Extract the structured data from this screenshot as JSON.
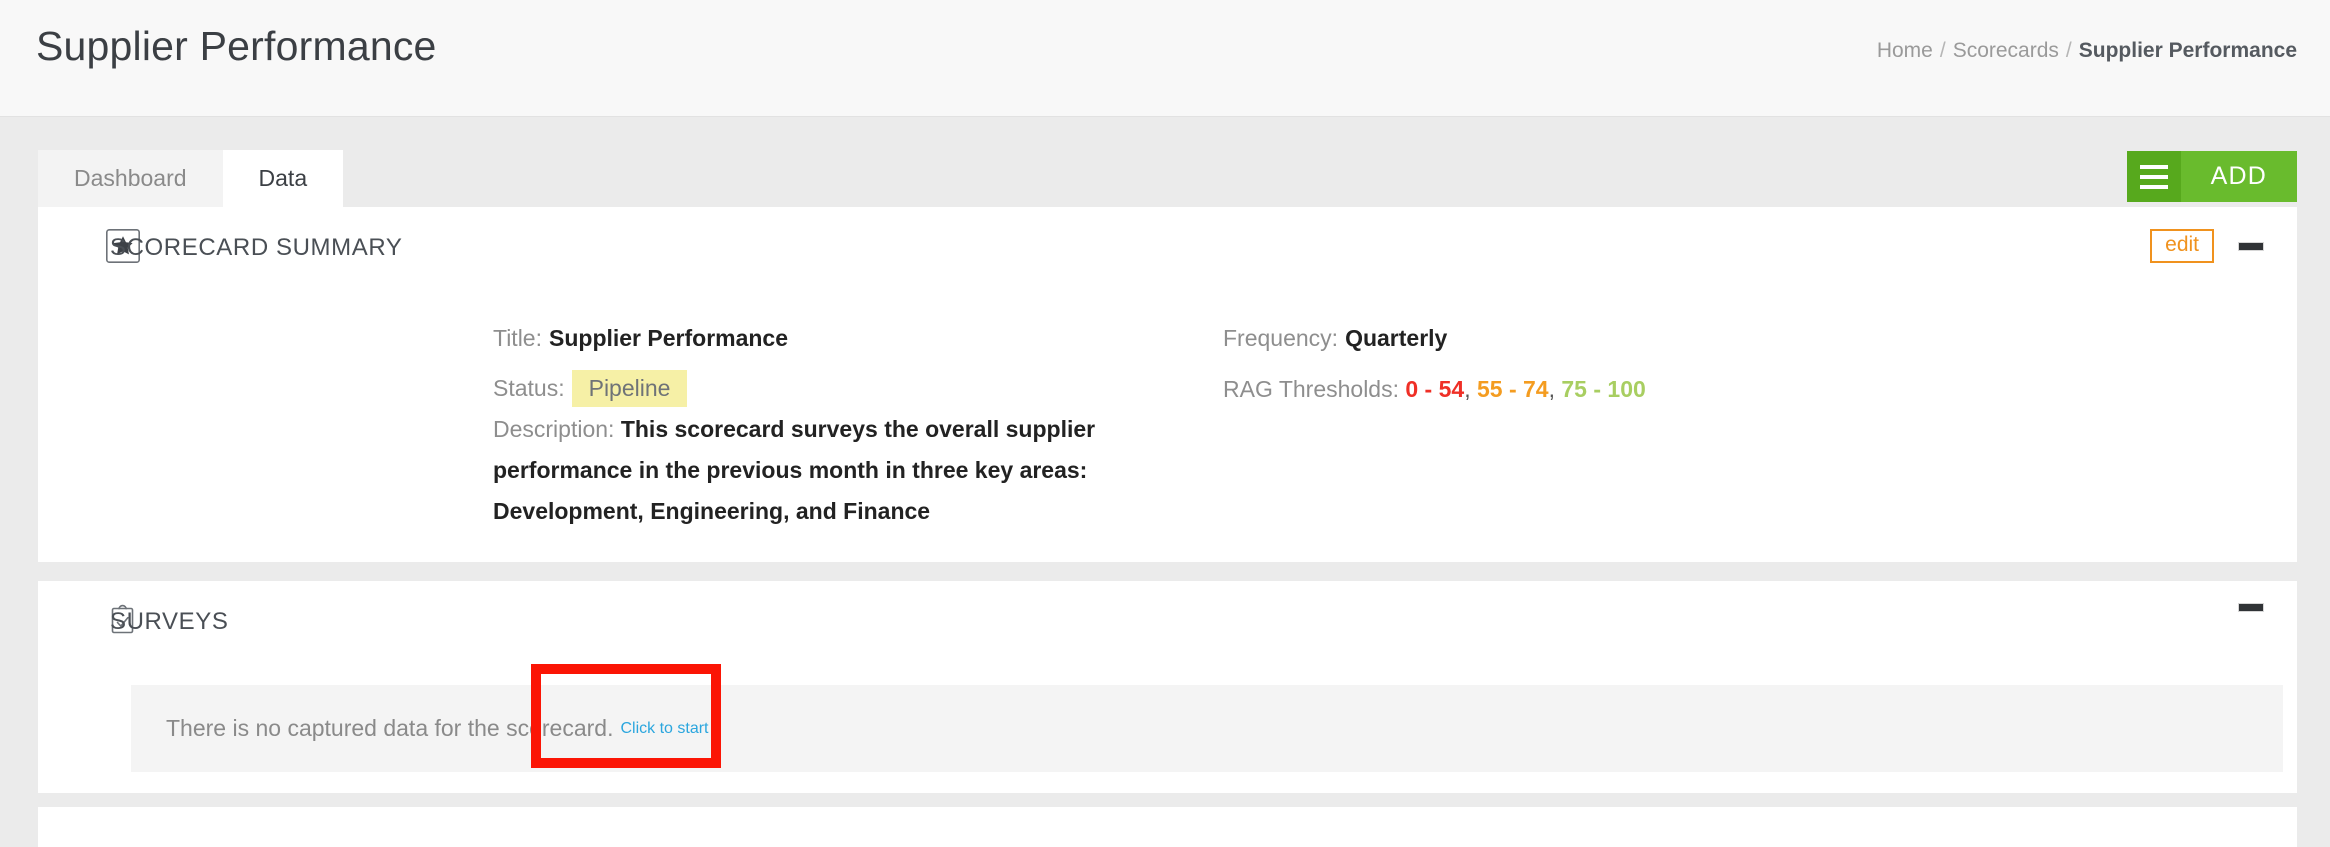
{
  "header": {
    "title": "Supplier Performance",
    "breadcrumb": {
      "home": "Home",
      "section": "Scorecards",
      "current": "Supplier Performance",
      "separator": "/"
    }
  },
  "toolbar": {
    "tabs": [
      {
        "label": "Dashboard",
        "active": false
      },
      {
        "label": "Data",
        "active": true
      }
    ],
    "add_button_label": "ADD",
    "menu_icon": "hamburger-icon"
  },
  "summary_card": {
    "icon": "star-icon",
    "title": "SCORECARD SUMMARY",
    "edit_label": "edit",
    "collapse_icon": "minus-icon",
    "fields": {
      "title_label": "Title:",
      "title_value": "Supplier Performance",
      "status_label": "Status:",
      "status_value": "Pipeline",
      "frequency_label": "Frequency:",
      "frequency_value": "Quarterly",
      "rag_label": "RAG Thresholds:",
      "rag_red": "0 - 54",
      "rag_amber": "55 - 74",
      "rag_green": "75 - 100",
      "rag_sep": ",",
      "description_label": "Description:",
      "description_value": "This scorecard surveys the overall supplier performance in the previous month in three key areas: Development, Engineering, and Finance"
    }
  },
  "surveys_card": {
    "icon": "clipboard-check-icon",
    "title": "SURVEYS",
    "collapse_icon": "minus-icon",
    "empty_message": "There is no captured data for the scorecard.",
    "start_link_label": "Click to start"
  },
  "annotation": {
    "color": "#fb1505",
    "target": "Click to start"
  },
  "colors": {
    "accent_green": "#69bb2d",
    "accent_green_dark": "#57a91d",
    "edit_orange": "#f0921e",
    "link_blue": "#2ba6de",
    "status_yellow": "#f6f0a6",
    "rag_red": "#ef2f26",
    "rag_amber": "#f49c20",
    "rag_green": "#a8ce61"
  }
}
